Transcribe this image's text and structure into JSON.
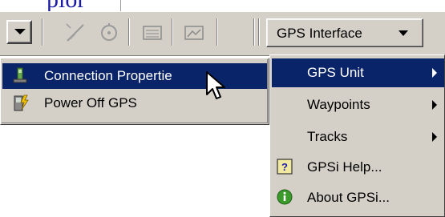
{
  "header": {
    "title_fragment": "plor"
  },
  "toolbar": {
    "icons": [
      "measure-tool-icon",
      "gps-track-icon",
      "table-icon",
      "map-view-icon"
    ],
    "gps_interface_label": "GPS Interface"
  },
  "left_menu": {
    "items": [
      {
        "label": "Connection Propertie",
        "icon": "connection-properties-icon",
        "highlighted": true
      },
      {
        "label": "Power Off GPS",
        "icon": "power-off-icon",
        "highlighted": false
      }
    ]
  },
  "right_menu": {
    "items": [
      {
        "label": "GPS Unit",
        "has_submenu": true,
        "highlighted": true
      },
      {
        "label": "Waypoints",
        "has_submenu": true,
        "highlighted": false
      },
      {
        "label": "Tracks",
        "has_submenu": true,
        "highlighted": false
      },
      {
        "label": "GPSi Help...",
        "icon": "help-icon",
        "has_submenu": false,
        "highlighted": false
      },
      {
        "label": "About GPSi...",
        "icon": "info-icon",
        "has_submenu": false,
        "highlighted": false
      }
    ]
  },
  "colors": {
    "menu_background": "#d4d0c8",
    "highlight": "#0a246a",
    "highlight_text": "#ffffff",
    "title_fragment_color": "#1a1aa6"
  }
}
